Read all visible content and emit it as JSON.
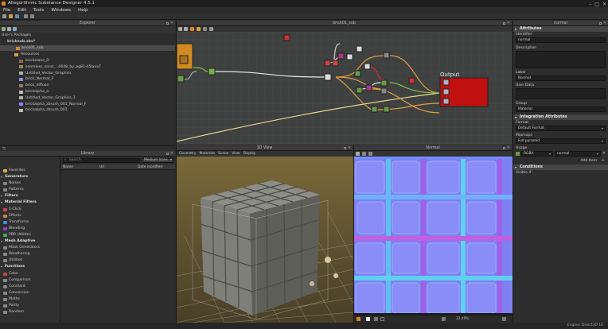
{
  "window": {
    "title": "Allegorithmic Substance Designer 4.5.1"
  },
  "menu": [
    "File",
    "Edit",
    "Tools",
    "Windows",
    "Help"
  ],
  "explorer": {
    "title": "Explorer",
    "users_packages": "User's Packages",
    "package": "bricksub.sbs*",
    "graph": "brick01_sub",
    "resources": "Resources",
    "items": [
      {
        "label": "brickstone_D",
        "color": "#8a6a4a"
      },
      {
        "label": "seamless_sand_...0648_by_ag81-d5laxa7",
        "color": "#9a8a5a"
      },
      {
        "label": "Untitled_Vector_Graphics",
        "color": "#b0b0b0"
      },
      {
        "label": "brick_Normal_F",
        "color": "#8a8aff"
      },
      {
        "label": "brick_diffuse",
        "color": "#9a7a5a"
      },
      {
        "label": "brickalpha_a",
        "color": "#bbbbbb"
      },
      {
        "label": "Untitled_Vector_Graphics_1",
        "color": "#b0b0b0"
      },
      {
        "label": "brickalpha_zbrush_001_Normal_F",
        "color": "#8a8aff"
      },
      {
        "label": "brickalpha_zbrush_001",
        "color": "#bbbbbb"
      }
    ]
  },
  "library": {
    "title": "Library",
    "search_placeholder": "Search",
    "size_option": "Medium Icons",
    "columns": {
      "name": "Name",
      "url": "Url",
      "date": "Date modified"
    },
    "entries": [
      {
        "type": "item",
        "label": "Favorites",
        "color": "#d9b43a"
      },
      {
        "type": "cat",
        "label": "Generators"
      },
      {
        "type": "item",
        "label": "Noises",
        "color": "#888888"
      },
      {
        "type": "item",
        "label": "Patterns",
        "color": "#888888"
      },
      {
        "type": "cat",
        "label": "Filters"
      },
      {
        "type": "cat",
        "label": "Material Filters"
      },
      {
        "type": "item",
        "label": "1-Click",
        "color": "#cc4444"
      },
      {
        "type": "item",
        "label": "Effects",
        "color": "#cc8844"
      },
      {
        "type": "item",
        "label": "Transforms",
        "color": "#4488cc"
      },
      {
        "type": "item",
        "label": "Blending",
        "color": "#8844cc"
      },
      {
        "type": "item",
        "label": "PBR Utilities",
        "color": "#44aa66"
      },
      {
        "type": "cat",
        "label": "Mesh Adaptive"
      },
      {
        "type": "item",
        "label": "Mask Generators",
        "color": "#888888"
      },
      {
        "type": "item",
        "label": "Weathering",
        "color": "#888888"
      },
      {
        "type": "item",
        "label": "Utilities",
        "color": "#888888"
      },
      {
        "type": "cat",
        "label": "Functions"
      },
      {
        "type": "item",
        "label": "Color",
        "color": "#cc4444"
      },
      {
        "type": "item",
        "label": "Comparison",
        "color": "#888888"
      },
      {
        "type": "item",
        "label": "Constant",
        "color": "#888888"
      },
      {
        "type": "item",
        "label": "Conversion",
        "color": "#888888"
      },
      {
        "type": "item",
        "label": "Maths",
        "color": "#888888"
      },
      {
        "type": "item",
        "label": "Parity",
        "color": "#888888"
      },
      {
        "type": "item",
        "label": "Random",
        "color": "#888888"
      }
    ]
  },
  "graph": {
    "title": "brick01_sub",
    "output_label": "Output"
  },
  "view3d": {
    "title": "3D View",
    "menu": [
      "Geometry",
      "Materials",
      "Scene",
      "View",
      "Display"
    ]
  },
  "view2d": {
    "title": "Normal",
    "zoom": "33.49%"
  },
  "attributes": {
    "title": "normal",
    "sec_attributes": "Attributes",
    "identifier_label": "Identifier",
    "identifier_value": "normal",
    "description_label": "Description",
    "label_label": "Label",
    "label_value": "Normal",
    "user_data_label": "User Data",
    "group_label": "Group",
    "group_value": "Material",
    "sec_integration": "Integration Attributes",
    "format_label": "Format",
    "format_value": "Default Format",
    "mipmaps_label": "Mipmaps",
    "mipmaps_value": "Full pyramid",
    "usage_label": "Usage",
    "usage_channel": "RGBA",
    "usage_value": "normal",
    "add_item": "Add Item",
    "sec_conditions": "Conditions",
    "visible_if_label": "Visible if"
  },
  "status": {
    "engine": "Engine: Direct3D 10"
  }
}
